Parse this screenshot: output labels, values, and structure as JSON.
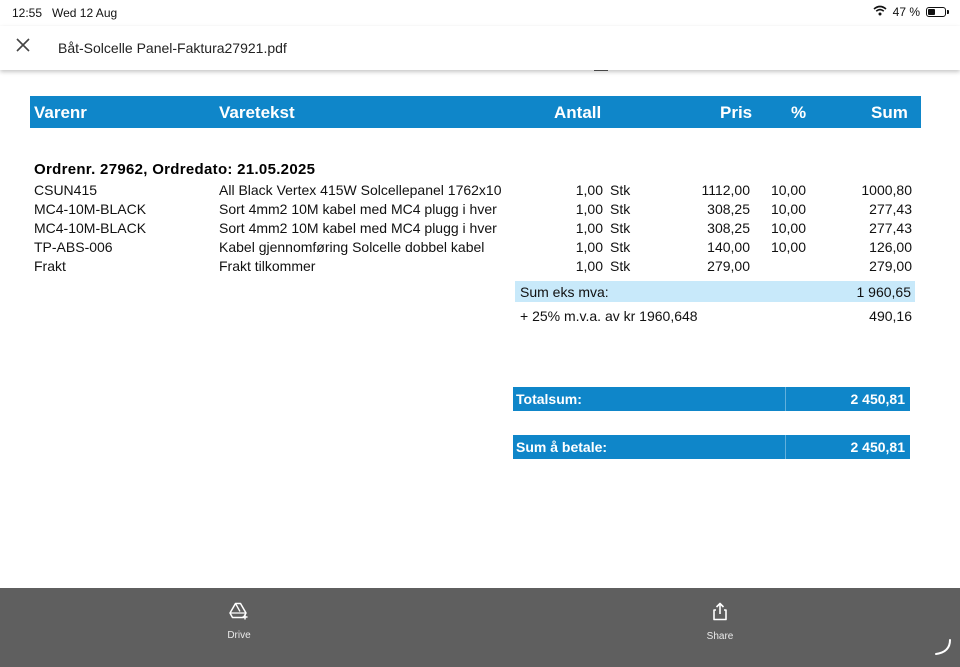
{
  "status_bar": {
    "time": "12:55",
    "date": "Wed 12 Aug",
    "battery": "47 %",
    "battery_level": 0.47
  },
  "title_bar": {
    "file_name": "Båt-Solcelle Panel-Faktura27921.pdf"
  },
  "invoice": {
    "headers": {
      "nr": "Varenr",
      "text": "Varetekst",
      "qty": "Antall",
      "price": "Pris",
      "pct": "%",
      "sum": "Sum"
    },
    "order_title": "Ordrenr. 27962, Ordredato: 21.05.2025",
    "lines": [
      {
        "nr": "CSUN415",
        "text": "All Black Vertex 415W Solcellepanel  1762x10",
        "qty": "1,00",
        "unit": "Stk",
        "price": "1112,00",
        "pct": "10,00",
        "sum": "1000,80"
      },
      {
        "nr": "MC4-10M-BLACK",
        "text": "Sort 4mm2 10M kabel med MC4 plugg i hver",
        "qty": "1,00",
        "unit": "Stk",
        "price": "308,25",
        "pct": "10,00",
        "sum": "277,43"
      },
      {
        "nr": "MC4-10M-BLACK",
        "text": "Sort 4mm2 10M kabel med MC4 plugg i hver",
        "qty": "1,00",
        "unit": "Stk",
        "price": "308,25",
        "pct": "10,00",
        "sum": "277,43"
      },
      {
        "nr": "TP-ABS-006",
        "text": "Kabel gjennomføring Solcelle dobbel kabel",
        "qty": "1,00",
        "unit": "Stk",
        "price": "140,00",
        "pct": "10,00",
        "sum": "126,00"
      },
      {
        "nr": "Frakt",
        "text": "Frakt tilkommer",
        "qty": "1,00",
        "unit": "Stk",
        "price": "279,00",
        "pct": "",
        "sum": "279,00"
      }
    ],
    "sum_ex_vat": {
      "label": "Sum eks mva:",
      "value": "1 960,65"
    },
    "vat": {
      "label": "+ 25% m.v.a. av kr 1960,648",
      "value": "490,16"
    },
    "total": {
      "label": "Totalsum:",
      "value": "2 450,81"
    },
    "to_pay": {
      "label": "Sum å betale:",
      "value": "2 450,81"
    }
  },
  "bottom_bar": {
    "drive_label": "Drive",
    "share_label": "Share"
  },
  "colors": {
    "header_blue": "#0f86c9",
    "light_blue": "#c8e9fa",
    "bottom_bar": "#5f5f5f"
  }
}
